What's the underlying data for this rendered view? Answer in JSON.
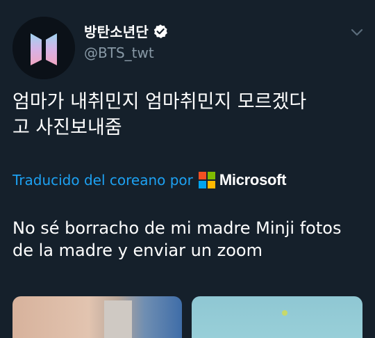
{
  "tweet": {
    "display_name": "방탄소년단",
    "handle": "@BTS_twt",
    "text_line1": "엄마가 내취민지 엄마취민지 모르겠다",
    "text_line2": "고 사진보내줌",
    "translate_label": "Traducido del coreano por",
    "translator": "Microsoft",
    "translation_line1": "No sé borracho de mi madre Minji fotos",
    "translation_line2": "de la madre y enviar un zoom"
  },
  "icons": {
    "avatar": "bts-logo-icon",
    "verified": "verified-badge-icon",
    "caret": "chevron-down-icon",
    "translator_logo": "microsoft-logo-icon"
  },
  "colors": {
    "background": "#15202b",
    "text": "#ffffff",
    "secondary_text": "#8899a6",
    "link": "#1da1f2",
    "ms_red": "#f25022",
    "ms_green": "#7fba00",
    "ms_blue": "#00a4ef",
    "ms_yellow": "#ffb900"
  }
}
